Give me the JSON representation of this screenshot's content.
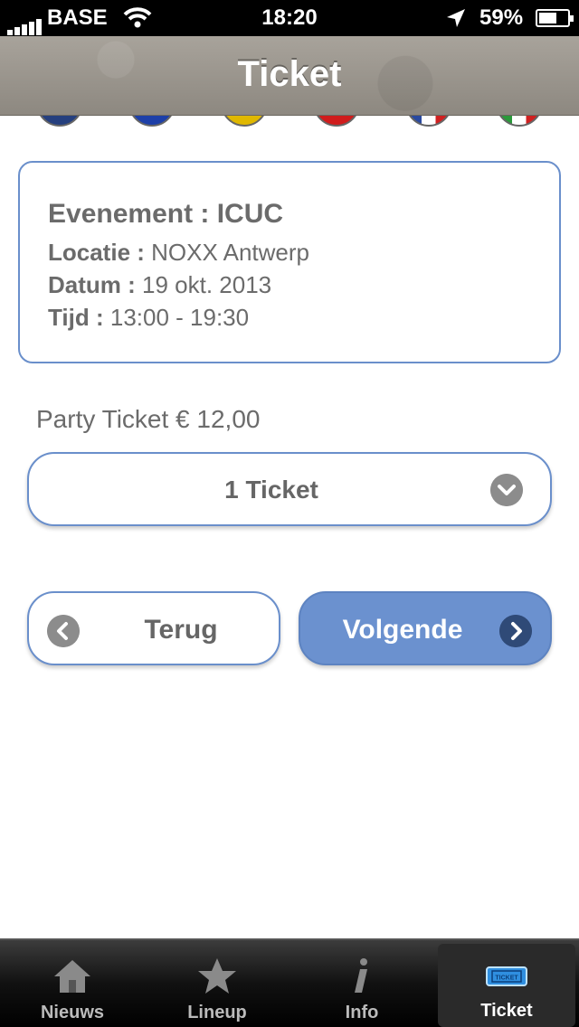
{
  "status_bar": {
    "carrier": "BASE",
    "time": "18:20",
    "battery": "59%"
  },
  "nav": {
    "title": "Ticket"
  },
  "event": {
    "title": "Evenement : ICUC",
    "location_label": "Locatie :",
    "location_value": "NOXX Antwerp",
    "date_label": "Datum :",
    "date_value": "19 okt. 2013",
    "time_label": "Tijd :",
    "time_value": "13:00 - 19:30"
  },
  "price_text": "Party Ticket € 12,00",
  "ticket_select": {
    "value": "1 Ticket"
  },
  "buttons": {
    "back": "Terug",
    "next": "Volgende"
  },
  "tabs": [
    {
      "label": "Nieuws",
      "icon": "house-icon"
    },
    {
      "label": "Lineup",
      "icon": "star-icon"
    },
    {
      "label": "Info",
      "icon": "info-icon"
    },
    {
      "label": "Ticket",
      "icon": "ticket-icon"
    }
  ],
  "colors": {
    "accent": "#6b91cf",
    "border": "#6a8fcb"
  }
}
